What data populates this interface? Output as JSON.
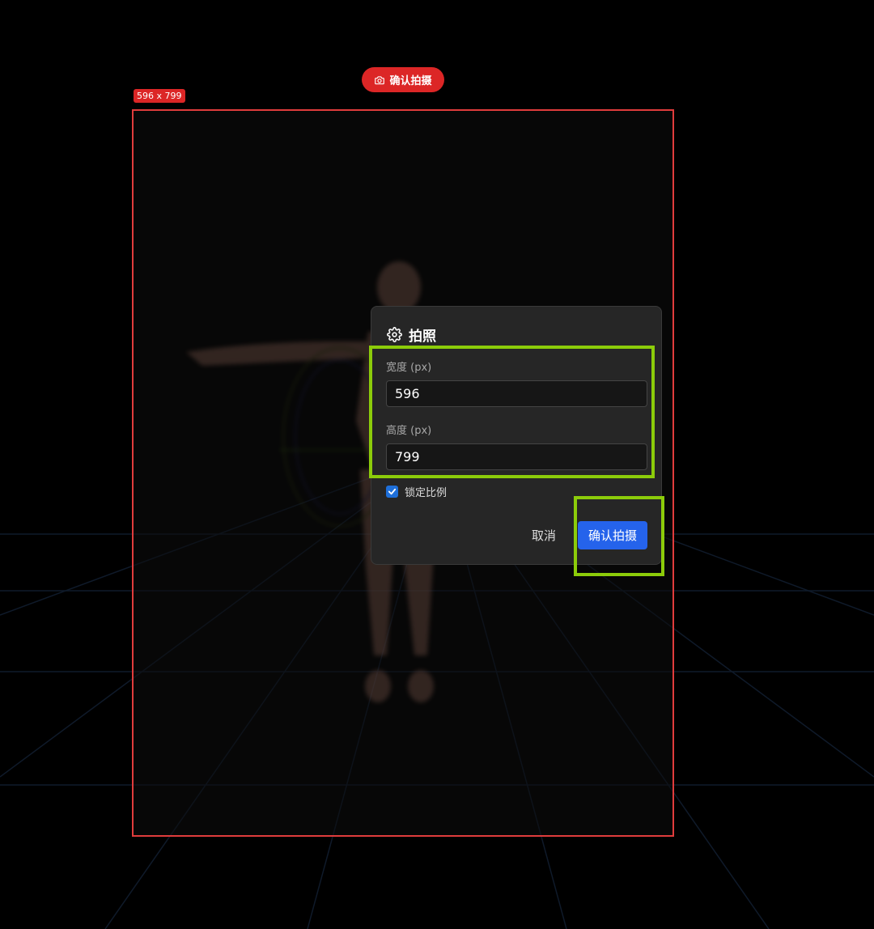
{
  "capture_button": {
    "label": "确认拍摄",
    "icon": "camera-icon",
    "color": "#dc2626"
  },
  "frame": {
    "size_badge": "596 x 799",
    "border_color": "#e03c3c"
  },
  "dialog": {
    "icon": "gear-icon",
    "title": "拍照",
    "width_label": "宽度 (px)",
    "width_value": "596",
    "height_label": "高度 (px)",
    "height_value": "799",
    "lock_ratio_label": "锁定比例",
    "lock_ratio_checked": true,
    "cancel_label": "取消",
    "confirm_label": "确认拍摄",
    "confirm_color": "#2563eb"
  },
  "highlight_color": "#8ccc0a"
}
